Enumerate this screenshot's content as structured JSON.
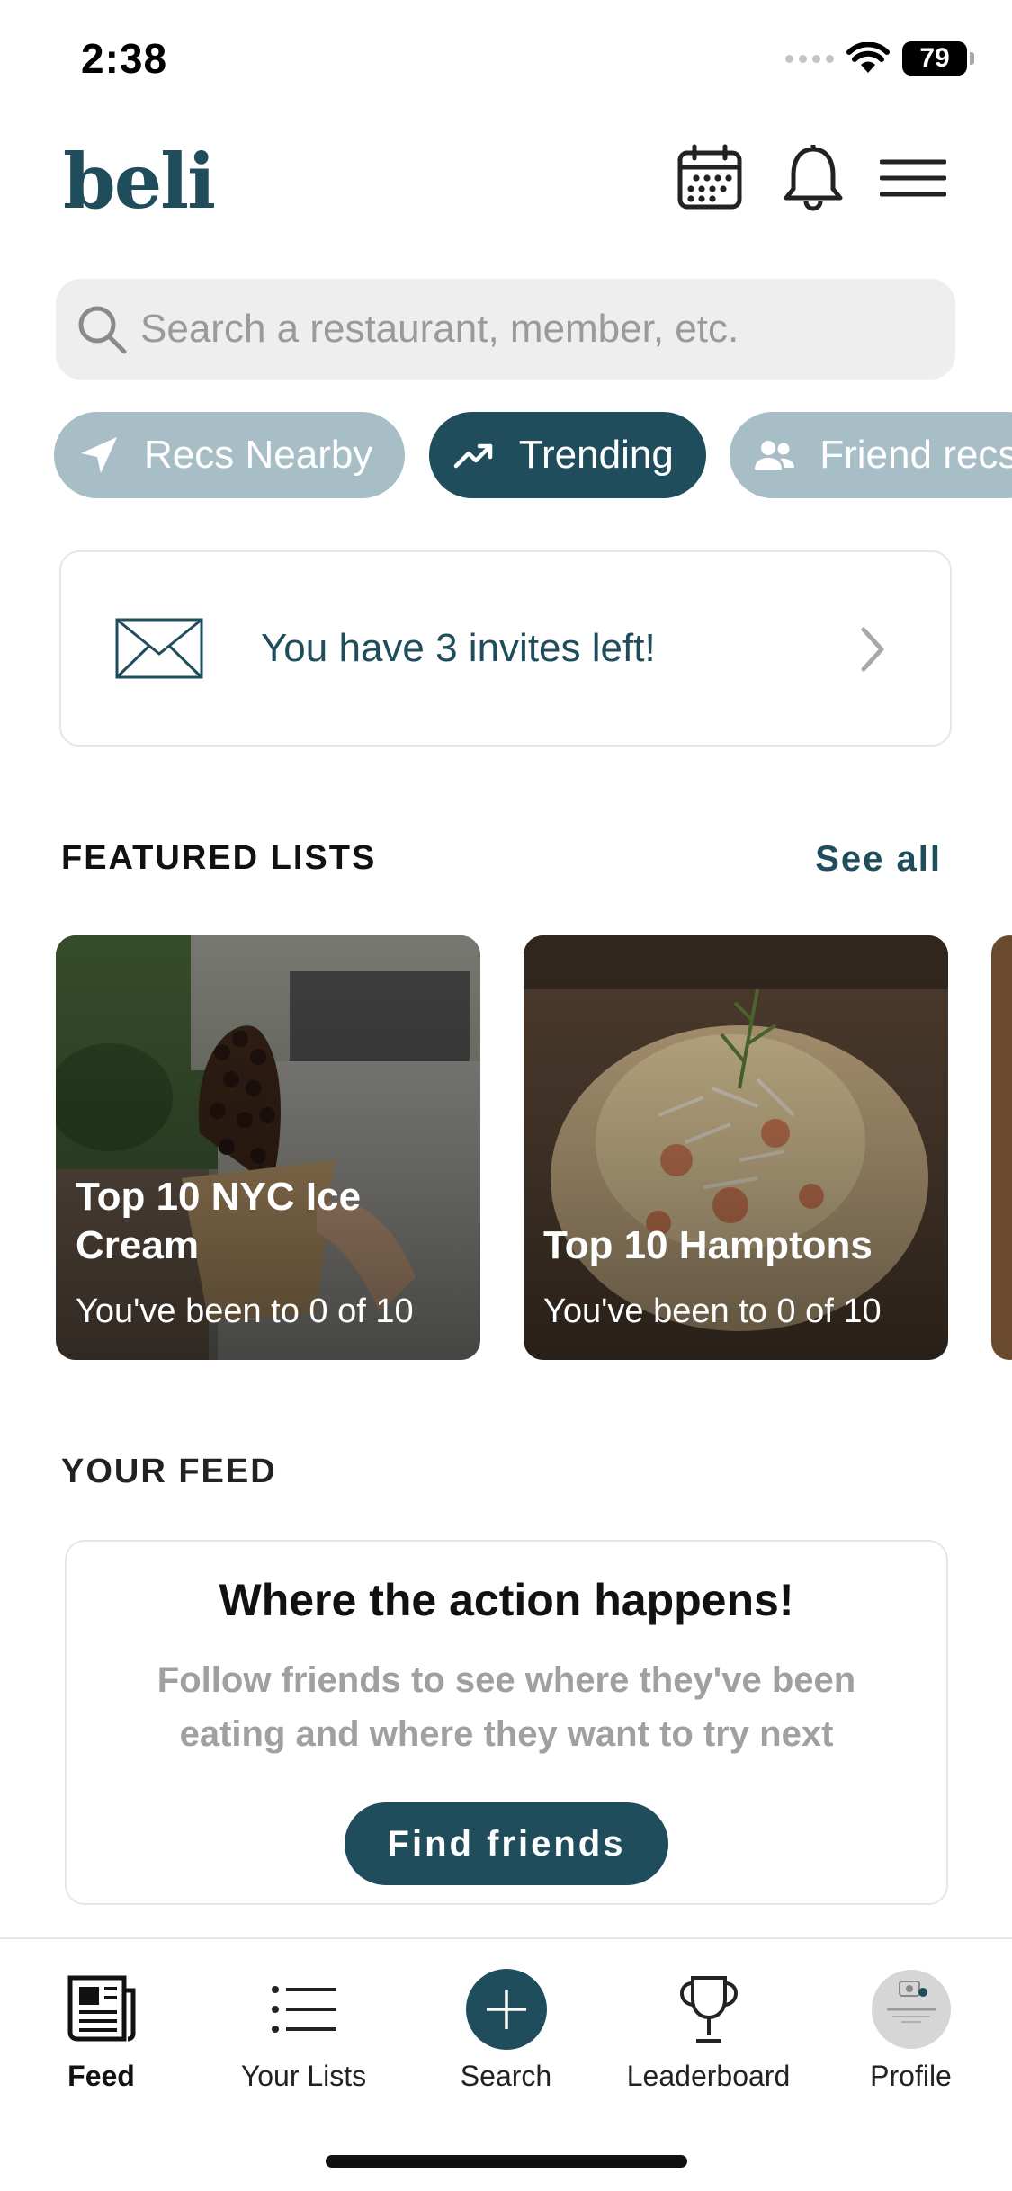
{
  "status": {
    "time": "2:38",
    "battery": "79"
  },
  "header": {
    "logo": "beli",
    "icons": [
      "calendar-icon",
      "bell-icon",
      "menu-icon"
    ]
  },
  "search": {
    "placeholder": "Search a restaurant, member, etc."
  },
  "chips": [
    {
      "label": "Recs Nearby",
      "icon": "location-arrow-icon",
      "active": false
    },
    {
      "label": "Trending",
      "icon": "trending-icon",
      "active": true
    },
    {
      "label": "Friend recs",
      "icon": "people-icon",
      "active": false
    }
  ],
  "invite": {
    "text": "You have 3 invites left!"
  },
  "featured": {
    "title": "FEATURED LISTS",
    "see_all": "See all",
    "cards": [
      {
        "title": "Top 10 NYC Ice Cream",
        "subtitle": "You've been to 0 of 10"
      },
      {
        "title": "Top 10 Hamptons",
        "subtitle": "You've been to 0 of 10"
      }
    ]
  },
  "feed": {
    "title": "YOUR FEED",
    "card_title": "Where the action happens!",
    "card_desc": "Follow friends to see where they've been eating and where they want to try next",
    "button": "Find friends"
  },
  "tabbar": {
    "feed": "Feed",
    "lists": "Your Lists",
    "search": "Search",
    "leaderboard": "Leaderboard",
    "profile": "Profile"
  },
  "colors": {
    "brand": "#1f4d5c",
    "chip_light": "#a8bec6"
  }
}
